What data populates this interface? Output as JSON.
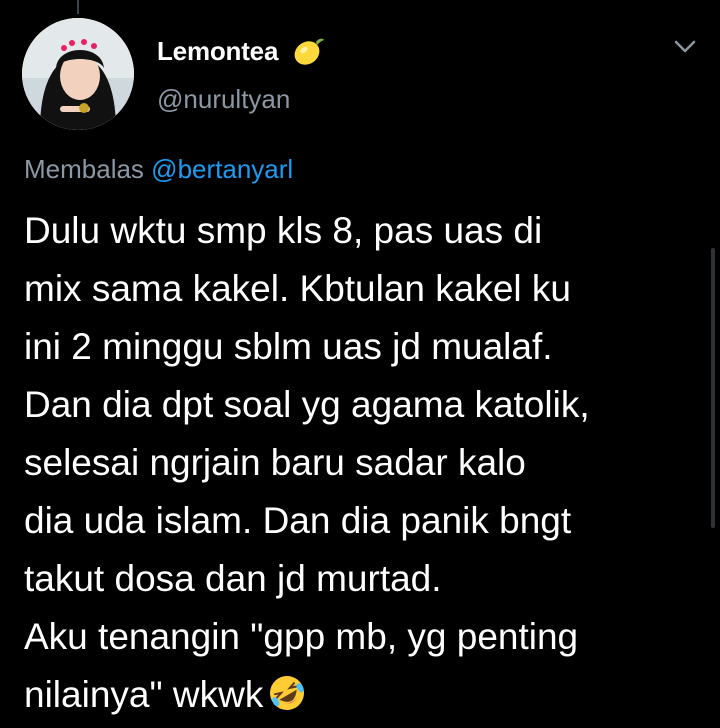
{
  "tweet": {
    "display_name": "Lemontea",
    "handle": "@nurultyan",
    "reply_prefix": "Membalas",
    "reply_mention": "@bertanyarl",
    "lines": [
      "Dulu wktu smp kls 8, pas uas di",
      "mix sama kakel. Kbtulan kakel ku",
      "ini 2 minggu sblm uas jd mualaf.",
      "Dan dia dpt soal yg agama katolik,",
      "selesai ngrjain baru sadar kalo",
      "dia uda islam. Dan dia panik bngt",
      "takut dosa dan jd murtad.",
      "Aku tenangin \"gpp mb, yg penting",
      "nilainya\" wkwk"
    ],
    "name_emoji": "lemon-icon",
    "end_emoji": "rolling-on-floor-laughing-icon"
  },
  "colors": {
    "background": "#000000",
    "text": "#ffffff",
    "secondary": "#8b98a5",
    "accent": "#1d9bf0"
  }
}
